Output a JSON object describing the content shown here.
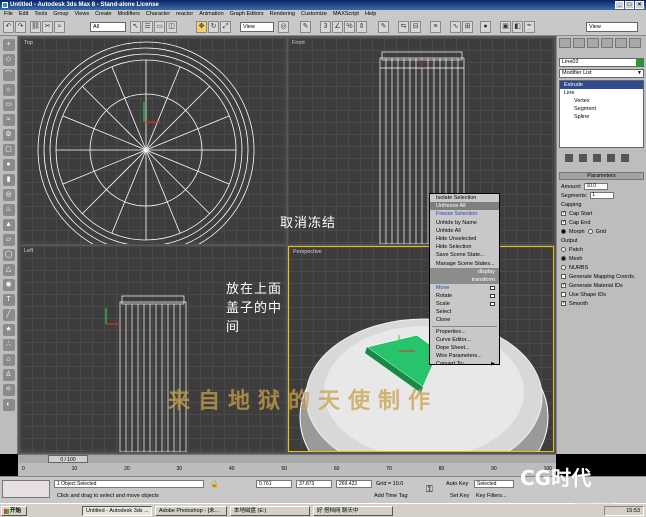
{
  "window": {
    "title": "Untitled - Autodesk 3ds Max 8 - Stand-alone License",
    "buttons": [
      "_",
      "□",
      "×"
    ]
  },
  "menu": [
    "File",
    "Edit",
    "Tools",
    "Group",
    "Views",
    "Create",
    "Modifiers",
    "Character",
    "reactor",
    "Animation",
    "Graph Editors",
    "Rendering",
    "Customize",
    "MAXScript",
    "Help"
  ],
  "toolbar": {
    "selection_filter": "All",
    "ref_coord": "View",
    "named_sel": "View"
  },
  "viewports": [
    {
      "label": "Top"
    },
    {
      "label": "Front"
    },
    {
      "label": "Left"
    },
    {
      "label": "Perspective"
    }
  ],
  "command_panel": {
    "object_name": "Line02",
    "modifier_list": "Modifier List",
    "stack": [
      "Extrude",
      "Line",
      "Vertex",
      "Segment",
      "Spline"
    ],
    "rollout": "Parameters",
    "amount_label": "Amount:",
    "amount": "10.0",
    "segments_label": "Segments:",
    "segments": "1",
    "capping_label": "Capping",
    "cap_start": "Cap Start",
    "cap_end": "Cap End",
    "morph": "Morph",
    "grid": "Grid",
    "output_label": "Output",
    "patch": "Patch",
    "mesh": "Mesh",
    "nurbs": "NURBS",
    "gen_mapping": "Generate Mapping Coords.",
    "gen_mat_ids": "Generate Material IDs",
    "use_shape_ids": "Use Shape IDs",
    "smooth": "Smooth"
  },
  "quad_menu": {
    "display_items": [
      "Isolate Selection",
      "Unfreeze All",
      "Freeze Selection",
      "Unhide by Name",
      "Unhide All",
      "Hide Unselected",
      "Hide Selection",
      "Save Scene State...",
      "Manage Scene States..."
    ],
    "display_header": "display",
    "transform_header": "transform",
    "transform_items": [
      "Move",
      "Rotate",
      "Scale",
      "Select",
      "Clone",
      "Properties...",
      "Curve Editor...",
      "Dope Sheet...",
      "Wire Parameters...",
      "Convert To:"
    ],
    "highlighted": "Unfreeze All"
  },
  "annotations": {
    "unfreeze_note": "取消冻结",
    "place_note": "放在上面盖子的中间",
    "watermark": "来自地狱的天使制作"
  },
  "timeline": {
    "frame": "0 / 100",
    "ticks": [
      "0",
      "10",
      "20",
      "30",
      "40",
      "50",
      "60",
      "70",
      "80",
      "90",
      "100"
    ]
  },
  "status": {
    "selected": "1 Object Selected",
    "prompt": "Click and drag to select and move objects",
    "x": "0.761",
    "y": "37.873",
    "z": "269.423",
    "grid": "Grid = 10.0",
    "add_time_tag": "Add Time Tag",
    "auto_key": "Auto Key",
    "set_key": "Set Key",
    "selected_dd": "Selected",
    "key_filters": "Key Filters..."
  },
  "taskbar": {
    "start": "开始",
    "tasks": [
      "Untitled - Autodesk 3ds ...",
      "Adobe Photoshop - [未...",
      "本地磁盘 (E:)",
      "好 搭档网 聊天中"
    ],
    "clock": "15:53"
  },
  "logo": {
    "text": "CG时代",
    "url": "cgtime.com.cn"
  },
  "colors": {
    "selected_object": "#27c46b",
    "active_viewport": "#f0c000",
    "titlebar": "#0a246a"
  }
}
